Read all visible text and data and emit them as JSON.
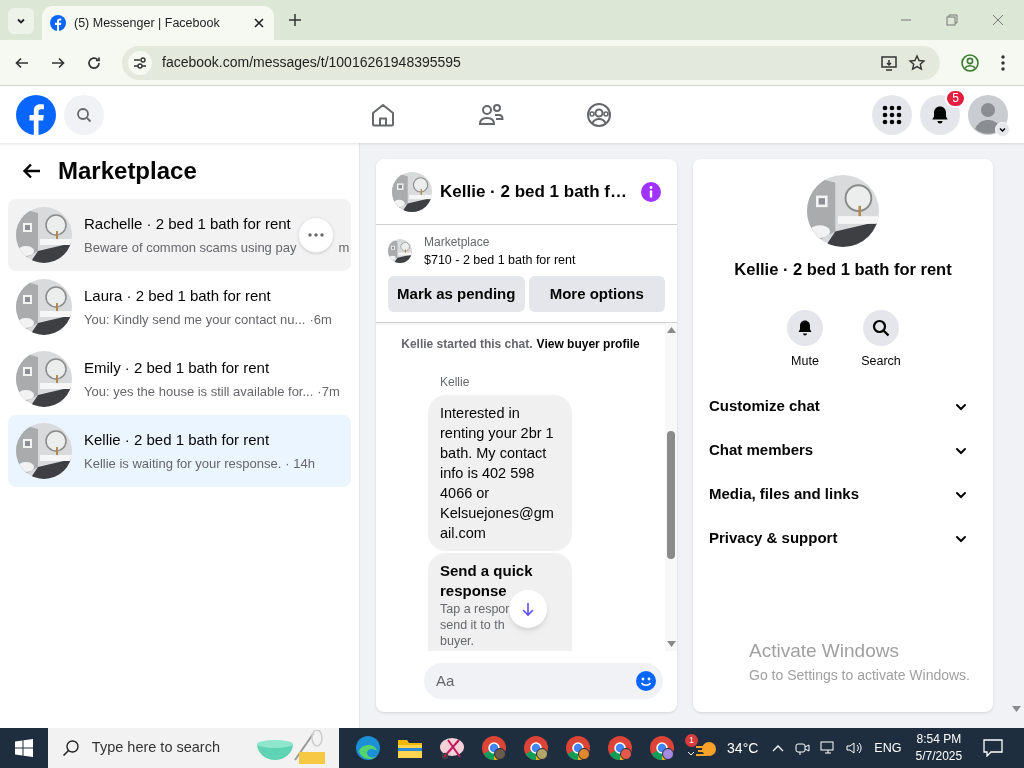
{
  "browser": {
    "tab_title": "(5) Messenger | Facebook",
    "url": "facebook.com/messages/t/10016261948395595"
  },
  "header": {
    "notification_count": "5"
  },
  "sidebar": {
    "title": "Marketplace",
    "conversations": [
      {
        "name": "Rachelle · 2 bed 1 bath for rent",
        "preview": "Beware of common scams using pay",
        "time": "m",
        "selected": false,
        "hovered": true
      },
      {
        "name": "Laura · 2 bed 1 bath for rent",
        "preview": "You: Kindly send me your contact nu...",
        "time": "·6m",
        "selected": false,
        "hovered": false
      },
      {
        "name": "Emily · 2 bed 1 bath for rent",
        "preview": "You: yes the house is still available for...",
        "time": "·7m",
        "selected": false,
        "hovered": false
      },
      {
        "name": "Kellie · 2 bed 1 bath for rent",
        "preview": "Kellie is waiting for your response.",
        "time": "· 14h",
        "selected": true,
        "hovered": false
      }
    ]
  },
  "chat": {
    "title": "Kellie · 2 bed 1 bath f…",
    "listing": {
      "label": "Marketplace",
      "title": "$710 - 2 bed 1 bath for rent"
    },
    "buttons": [
      "Mark as pending",
      "More options"
    ],
    "notice": "Kellie started this chat.",
    "notice_link": "View buyer profile",
    "messages": [
      {
        "kind": "text",
        "sender": "Kellie",
        "text": "Interested in renting your 2br 1 bath. My contact info is 402 598 4066 or Kelsuejones@gmail.com"
      },
      {
        "kind": "quick_response",
        "title": "Send a quick response",
        "lines": [
          "Tap a respon",
          "send it to th",
          "buyer."
        ]
      }
    ],
    "composer": {
      "placeholder": "Aa"
    }
  },
  "details": {
    "title": "Kellie · 2 bed 1 bath for rent",
    "actions": [
      {
        "kind": "mute",
        "label": "Mute"
      },
      {
        "kind": "search",
        "label": "Search"
      }
    ],
    "sections": [
      {
        "label": "Customize chat",
        "expanded": false
      },
      {
        "label": "Chat members",
        "expanded": false
      },
      {
        "label": "Media, files and links",
        "expanded": false
      },
      {
        "label": "Privacy & support",
        "expanded": false
      }
    ]
  },
  "activation": {
    "title": "Activate Windows",
    "subtitle": "Go to Settings to activate Windows."
  },
  "taskbar": {
    "search_placeholder": "Type here to search",
    "weather_badge": "1",
    "temperature": "34°C",
    "language": "ENG",
    "time": "8:54 PM",
    "date": "5/7/2025"
  }
}
